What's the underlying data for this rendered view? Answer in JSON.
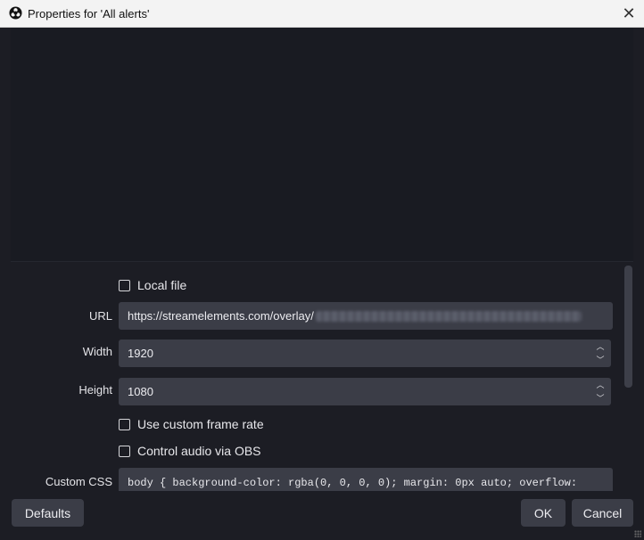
{
  "window": {
    "title": "Properties for 'All alerts'",
    "close_glyph": "✕",
    "app_icon": "obs-logo-icon"
  },
  "properties": {
    "local_file": {
      "label": "Local file",
      "checked": false
    },
    "url": {
      "label": "URL",
      "value": "https://streamelements.com/overlay/"
    },
    "width": {
      "label": "Width",
      "value": "1920"
    },
    "height": {
      "label": "Height",
      "value": "1080"
    },
    "custom_frame_rate": {
      "label": "Use custom frame rate",
      "checked": false
    },
    "control_audio": {
      "label": "Control audio via OBS",
      "checked": false
    },
    "custom_css": {
      "label": "Custom CSS",
      "value": "body { background-color: rgba(0, 0, 0, 0); margin: 0px auto; overflow:"
    }
  },
  "spinner": {
    "up_glyph": "︿",
    "down_glyph": "﹀"
  },
  "buttons": {
    "defaults": "Defaults",
    "ok": "OK",
    "cancel": "Cancel"
  },
  "colors": {
    "background": "#1c1d24",
    "field": "#3b3d47",
    "titlebar": "#f3f3f3"
  }
}
